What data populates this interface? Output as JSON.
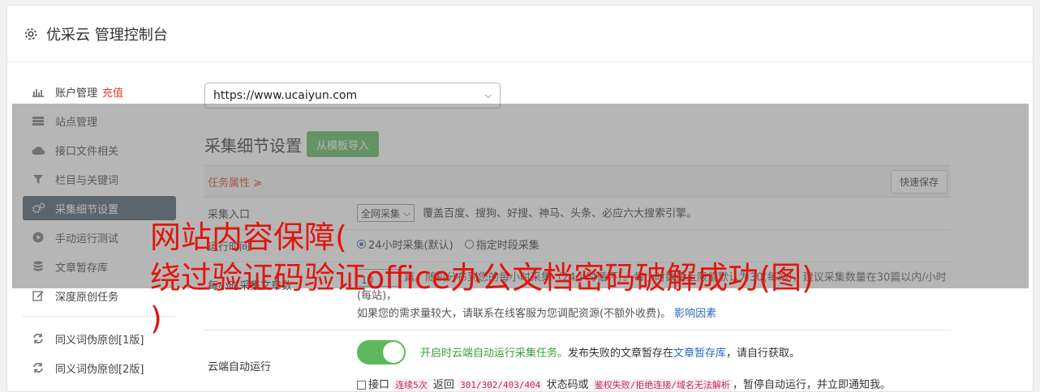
{
  "header": {
    "title": "优采云 管理控制台"
  },
  "sidebar": {
    "items": [
      {
        "label": "账户管理",
        "badge": "充值",
        "icon": "bar-chart-icon"
      },
      {
        "label": "站点管理",
        "icon": "server-icon"
      },
      {
        "label": "接口文件相关",
        "icon": "cloud-upload-icon"
      },
      {
        "label": "栏目与关键词",
        "icon": "filter-icon"
      },
      {
        "label": "采集细节设置",
        "icon": "cogs-icon",
        "active": true
      },
      {
        "label": "手动运行测试",
        "icon": "play-circle-icon"
      },
      {
        "label": "文章暂存库",
        "icon": "database-icon"
      },
      {
        "label": "深度原创任务",
        "icon": "edit-icon"
      }
    ],
    "items2": [
      {
        "label": "同义词伪原创[1版]",
        "icon": "refresh-icon"
      },
      {
        "label": "同义词伪原创[2版]",
        "icon": "refresh-icon"
      }
    ]
  },
  "main": {
    "site_select": "https://www.ucaiyun.com",
    "section_title": "采集细节设置",
    "import_button": "从模板导入",
    "task_props": "任务属性 ≽",
    "quick_save": "快速保存",
    "rows": {
      "entry": {
        "label": "采集入口",
        "select": "全网采集",
        "desc": "覆盖百度、搜狗、好搜、神马、头条、必应六大搜索引擎。"
      },
      "time": {
        "label": "运行时间",
        "opt1": "24小时采集(默认)",
        "opt2": "指定时段采集"
      },
      "count": {
        "label": "每小时采集文章数",
        "value": "10",
        "line1": "篇。随机分布到您的每小时采集（24小时循环）。每小时数量上限值默认为30(每站)，建议采集数量在30篇以内/小时(每站)，",
        "line2": "如果您的需求量较大，请联系在线客服为您调配资源(不额外收费)。",
        "link": "影响因素"
      },
      "cloud": {
        "label": "云端自动运行",
        "line1_green": "开启时云端自动运行采集任务。",
        "line1_rest": "发布失败的文章暂存在",
        "line1_link": "文章暂存库",
        "line1_end": "，请自行获取。",
        "line2_a": "接口",
        "line2_code1": "连续5次",
        "line2_b": "返回",
        "line2_code2": "301/302/403/404",
        "line2_c": "状态码或",
        "line2_code3": "鉴权失败/拒绝连接/域名无法解析",
        "line2_d": "，暂停自动运行，并立即通知我。"
      }
    }
  },
  "watermark": {
    "line1": "网站内容保障(",
    "line2": "绕过验证码验证office办公文档密码破解成功(图)",
    "line3": ")"
  },
  "colors": {
    "accent_green": "#5cb85c",
    "active_nav": "#4a5a6a",
    "red": "#d9412c",
    "watermark": "#e0160e"
  }
}
